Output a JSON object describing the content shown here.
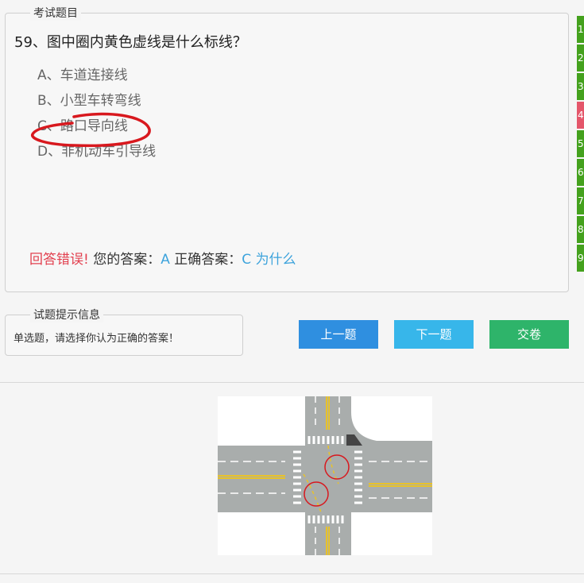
{
  "question_box": {
    "legend": "考试题目"
  },
  "question": {
    "title": "59、图中圈内黄色虚线是什么标线？",
    "options": [
      {
        "label": "A、车道连接线"
      },
      {
        "label": "B、小型车转弯线"
      },
      {
        "label": "C、路口导向线"
      },
      {
        "label": "D、非机动车引导线"
      }
    ],
    "annotation_color": "#d8181e"
  },
  "result": {
    "status": "回答错误!",
    "your_answer_label": "您的答案：",
    "your_answer": "A",
    "correct_answer_label": "正确答案：",
    "correct_answer": "C",
    "why_link": "为什么"
  },
  "hint": {
    "legend": "试题提示信息",
    "text": "单选题，请选择你认为正确的答案！"
  },
  "buttons": {
    "prev": "上一题",
    "next": "下一题",
    "submit": "交卷"
  },
  "nav": {
    "items": [
      {
        "label": "1",
        "status": "correct"
      },
      {
        "label": "2",
        "status": "correct"
      },
      {
        "label": "3",
        "status": "correct"
      },
      {
        "label": "4",
        "status": "wrong"
      },
      {
        "label": "5",
        "status": "correct"
      },
      {
        "label": "6",
        "status": "correct"
      },
      {
        "label": "7",
        "status": "correct"
      },
      {
        "label": "8",
        "status": "correct"
      },
      {
        "label": "9",
        "status": "correct"
      }
    ]
  },
  "colors": {
    "correct": "#44a11d",
    "wrong": "#e4566a",
    "road": "#a9adac",
    "yellow_line": "#e8c22a"
  }
}
